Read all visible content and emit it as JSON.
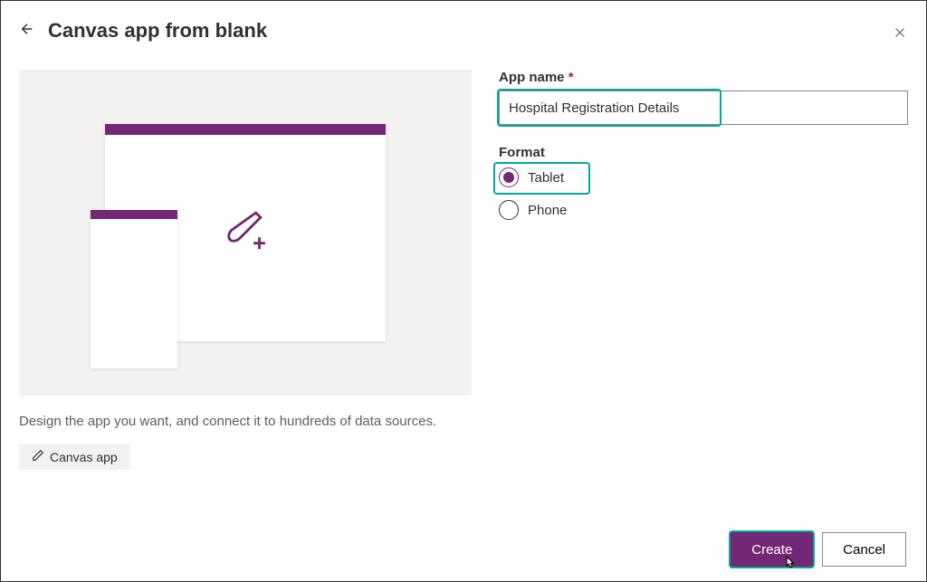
{
  "header": {
    "title": "Canvas app from blank"
  },
  "left": {
    "description": "Design the app you want, and connect it to hundreds of data sources.",
    "tag": "Canvas app"
  },
  "form": {
    "appNameLabel": "App name",
    "requiredMark": "*",
    "appNameValue": "Hospital Registration Details",
    "formatLabel": "Format",
    "options": {
      "tablet": "Tablet",
      "phone": "Phone"
    }
  },
  "footer": {
    "create": "Create",
    "cancel": "Cancel"
  }
}
